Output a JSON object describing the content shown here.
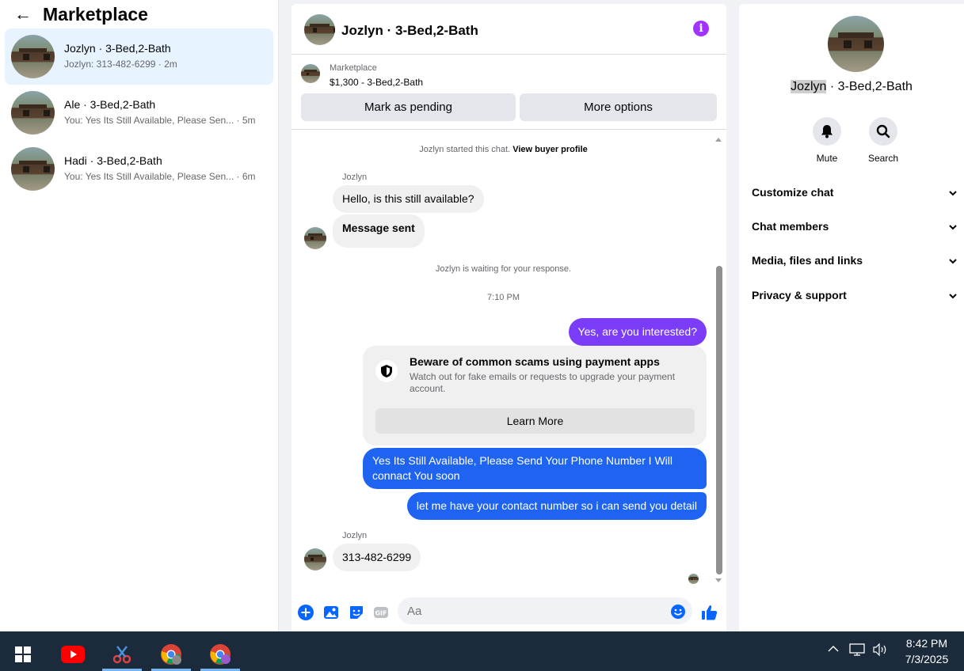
{
  "left": {
    "title": "Marketplace",
    "conversations": [
      {
        "name": "Jozlyn · 3-Bed,2-Bath",
        "preview": "Jozlyn: 313-482-6299",
        "time": "2m",
        "active": true
      },
      {
        "name": "Ale · 3-Bed,2-Bath",
        "preview": "You: Yes Its Still Available, Please Sen...",
        "time": "5m"
      },
      {
        "name": "Hadi · 3-Bed,2-Bath",
        "preview": "You: Yes Its Still Available, Please Sen...",
        "time": "6m"
      }
    ]
  },
  "chat": {
    "title": "Jozlyn · 3-Bed,2-Bath",
    "marketplace_label": "Marketplace",
    "listing": "$1,300 - 3-Bed,2-Bath",
    "mark_pending": "Mark as pending",
    "more_options": "More options",
    "started_text": "Jozlyn started this chat.",
    "view_profile": "View buyer profile",
    "sender_name": "Jozlyn",
    "msg_hello": "Hello, is this still available?",
    "msg_sent": "Message sent",
    "waiting_text": "Jozlyn is waiting for your response.",
    "time": "7:10 PM",
    "msg_interested": "Yes, are you interested?",
    "scam_title": "Beware of common scams using payment apps",
    "scam_body": "Watch out for fake emails or requests to upgrade your payment account.",
    "learn_more": "Learn More",
    "msg_available_1": "Yes Its Still Available, Please Send Your Phone Number I Will",
    "msg_available_2": "connact You soon",
    "msg_contact": "let me have your contact number so i can send you detail",
    "msg_phone": "313-482-6299",
    "input_placeholder": "Aa"
  },
  "right": {
    "name_highlight": "Jozlyn",
    "name_rest": " · 3-Bed,2-Bath",
    "mute": "Mute",
    "search": "Search",
    "sections": [
      "Customize chat",
      "Chat members",
      "Media, files and links",
      "Privacy & support"
    ]
  },
  "taskbar": {
    "time": "8:42 PM",
    "date": "7/3/2025"
  },
  "colors": {
    "accent_blue": "#1f64f0",
    "accent_purple": "#7a3cf7",
    "info_purple": "#a033ff",
    "active_row": "#e7f3ff",
    "taskbar": "#1c2b3c"
  }
}
